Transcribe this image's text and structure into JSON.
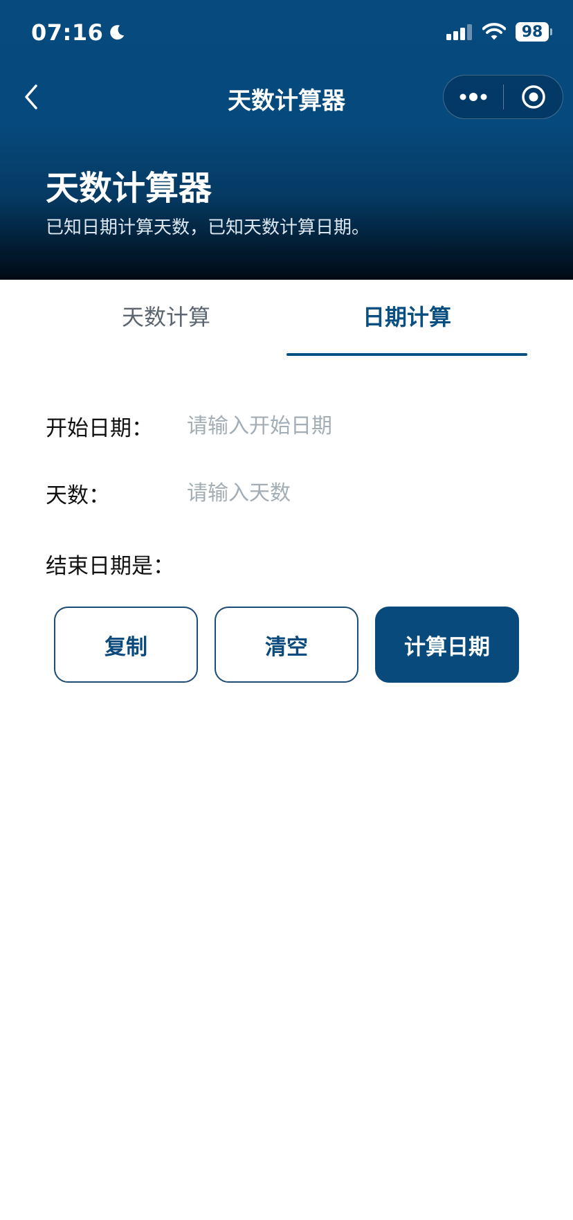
{
  "status_bar": {
    "time": "07:16",
    "battery": "98"
  },
  "nav": {
    "title": "天数计算器"
  },
  "hero": {
    "title": "天数计算器",
    "subtitle": "已知日期计算天数，已知天数计算日期。"
  },
  "tabs": [
    {
      "label": "天数计算",
      "active": false
    },
    {
      "label": "日期计算",
      "active": true
    }
  ],
  "form": {
    "start_date": {
      "label": "开始日期：",
      "value": "",
      "placeholder": "请输入开始日期"
    },
    "days": {
      "label": "天数：",
      "value": "",
      "placeholder": "请输入天数"
    },
    "end_date": {
      "label": "结束日期是：",
      "value": ""
    }
  },
  "buttons": {
    "copy": "复制",
    "clear": "清空",
    "calculate": "计算日期"
  },
  "colors": {
    "brand": "#074a7b",
    "header_dark": "#010a14",
    "placeholder": "#a3adb5"
  },
  "icons": {
    "back": "chevron-left-icon",
    "more": "more-dots-icon",
    "close": "target-circle-icon",
    "moon": "moon-icon",
    "signal": "signal-icon",
    "wifi": "wifi-icon"
  }
}
